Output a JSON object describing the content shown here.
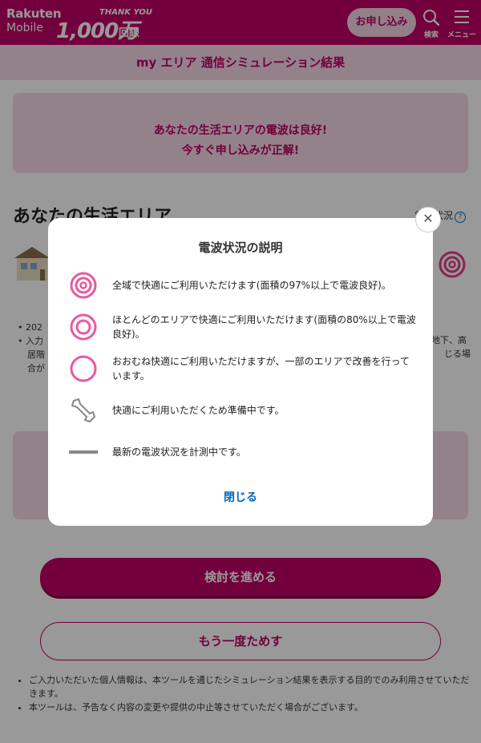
{
  "header": {
    "brand_line1": "Rakuten",
    "brand_line2": "Mobile",
    "campaign_small": "THANK YOU",
    "campaign_big": "1,000万",
    "campaign_unit": "回線",
    "apply_label": "お申し込み",
    "search_label": "検索",
    "menu_label": "メニュー"
  },
  "subtitle": "my エリア 通信シミュレーション結果",
  "result": {
    "line1": "あなたの生活エリアの電波は良好!",
    "line2": "今すぐ申し込みが正解!"
  },
  "section": {
    "title": "あなたの生活エリア",
    "status_link": "電波状況"
  },
  "notes": {
    "left_line1": "202",
    "left_line2": "入力",
    "left_line3": "居階",
    "left_line4": "合が",
    "right_line1": "地下、高",
    "right_line2": "じる場"
  },
  "buttons": {
    "proceed": "検討を進める",
    "retry": "もう一度ためす"
  },
  "disclaimer": [
    "ご入力いただいた個人情報は、本ツールを通じたシミュレーション結果を表示する目的でのみ利用させていただきます。",
    "本ツールは、予告なく内容の変更や提供の中止等させていただく場合がございます。"
  ],
  "modal": {
    "title": "電波状況の説明",
    "close_label": "閉じる",
    "legend": [
      {
        "icon": "signal-excellent-icon",
        "text": "全域で快適にご利用いただけます(面積の97%以上で電波良好)。"
      },
      {
        "icon": "signal-good-icon",
        "text": "ほとんどのエリアで快適にご利用いただけます(面積の80%以上で電波良好)。"
      },
      {
        "icon": "signal-fair-icon",
        "text": "おおむね快適にご利用いただけますが、一部のエリアで改善を行っています。"
      },
      {
        "icon": "wrench-icon",
        "text": "快適にご利用いただくため準備中です。"
      },
      {
        "icon": "dash-icon",
        "text": "最新の電波状況を計測中です。"
      }
    ]
  },
  "colors": {
    "brand": "#bf0064",
    "brand_light": "#f7d9e8",
    "link": "#0067b8"
  }
}
